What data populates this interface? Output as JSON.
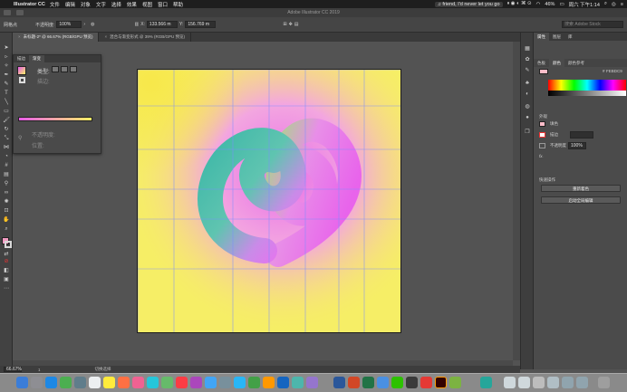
{
  "menubar": {
    "app": "Illustrator CC",
    "items": [
      "文件",
      "编辑",
      "对象",
      "文字",
      "选择",
      "效果",
      "视图",
      "窗口",
      "帮助"
    ],
    "now_playing": "friend, I'd never let you go",
    "battery": "46%",
    "clock": "周六 下午1:14"
  },
  "titlebar": {
    "title": "Adobe Illustrator CC 2019"
  },
  "controlbar": {
    "selection_label": "网格点",
    "opacity_label": "不透明度:",
    "opacity_value": "100%",
    "x_label": "X:",
    "x_value": "133.566 m",
    "y_label": "Y:",
    "y_value": "156.769 m",
    "search_placeholder": "搜索 Adobe Stock"
  },
  "doc_tabs": [
    {
      "label": "未标题-2* @ 66.67% (RGB/GPU 预览)",
      "active": true
    },
    {
      "label": "混合与渐变形式 @ 39% (RGB/GPU 预览)",
      "active": false
    }
  ],
  "gradient_panel": {
    "tabs": [
      "描边",
      "渐变"
    ],
    "type_label": "类型:",
    "stroke_label": "描边:",
    "opacity_label": "不透明度:",
    "location_label": "位置:"
  },
  "status": {
    "zoom": "66.67%",
    "page": "1",
    "tool": "切换选择"
  },
  "right_panel": {
    "tabs": [
      "属性",
      "图层",
      "库"
    ],
    "color_tabs": [
      "色板",
      "颜色",
      "颜色参考"
    ],
    "hex_prefix": "#",
    "hex_value": "FEBDC9",
    "appearance_header": "外观",
    "fill_label": "填色",
    "stroke_label": "描边",
    "opacity_label": "不透明度",
    "opacity_value": "100%",
    "fx_label": "fx.",
    "quick_actions_header": "快速操作",
    "btn_recolor": "重新着色",
    "btn_global_edit": "启动全局编辑"
  },
  "colors": {
    "accent_pink": "#FEBDC9",
    "gradient_start": "#e85ce8",
    "gradient_end": "#f5f064",
    "ribbon_teal": "#3fb8a8",
    "ribbon_magenta": "#ec6ff0"
  }
}
